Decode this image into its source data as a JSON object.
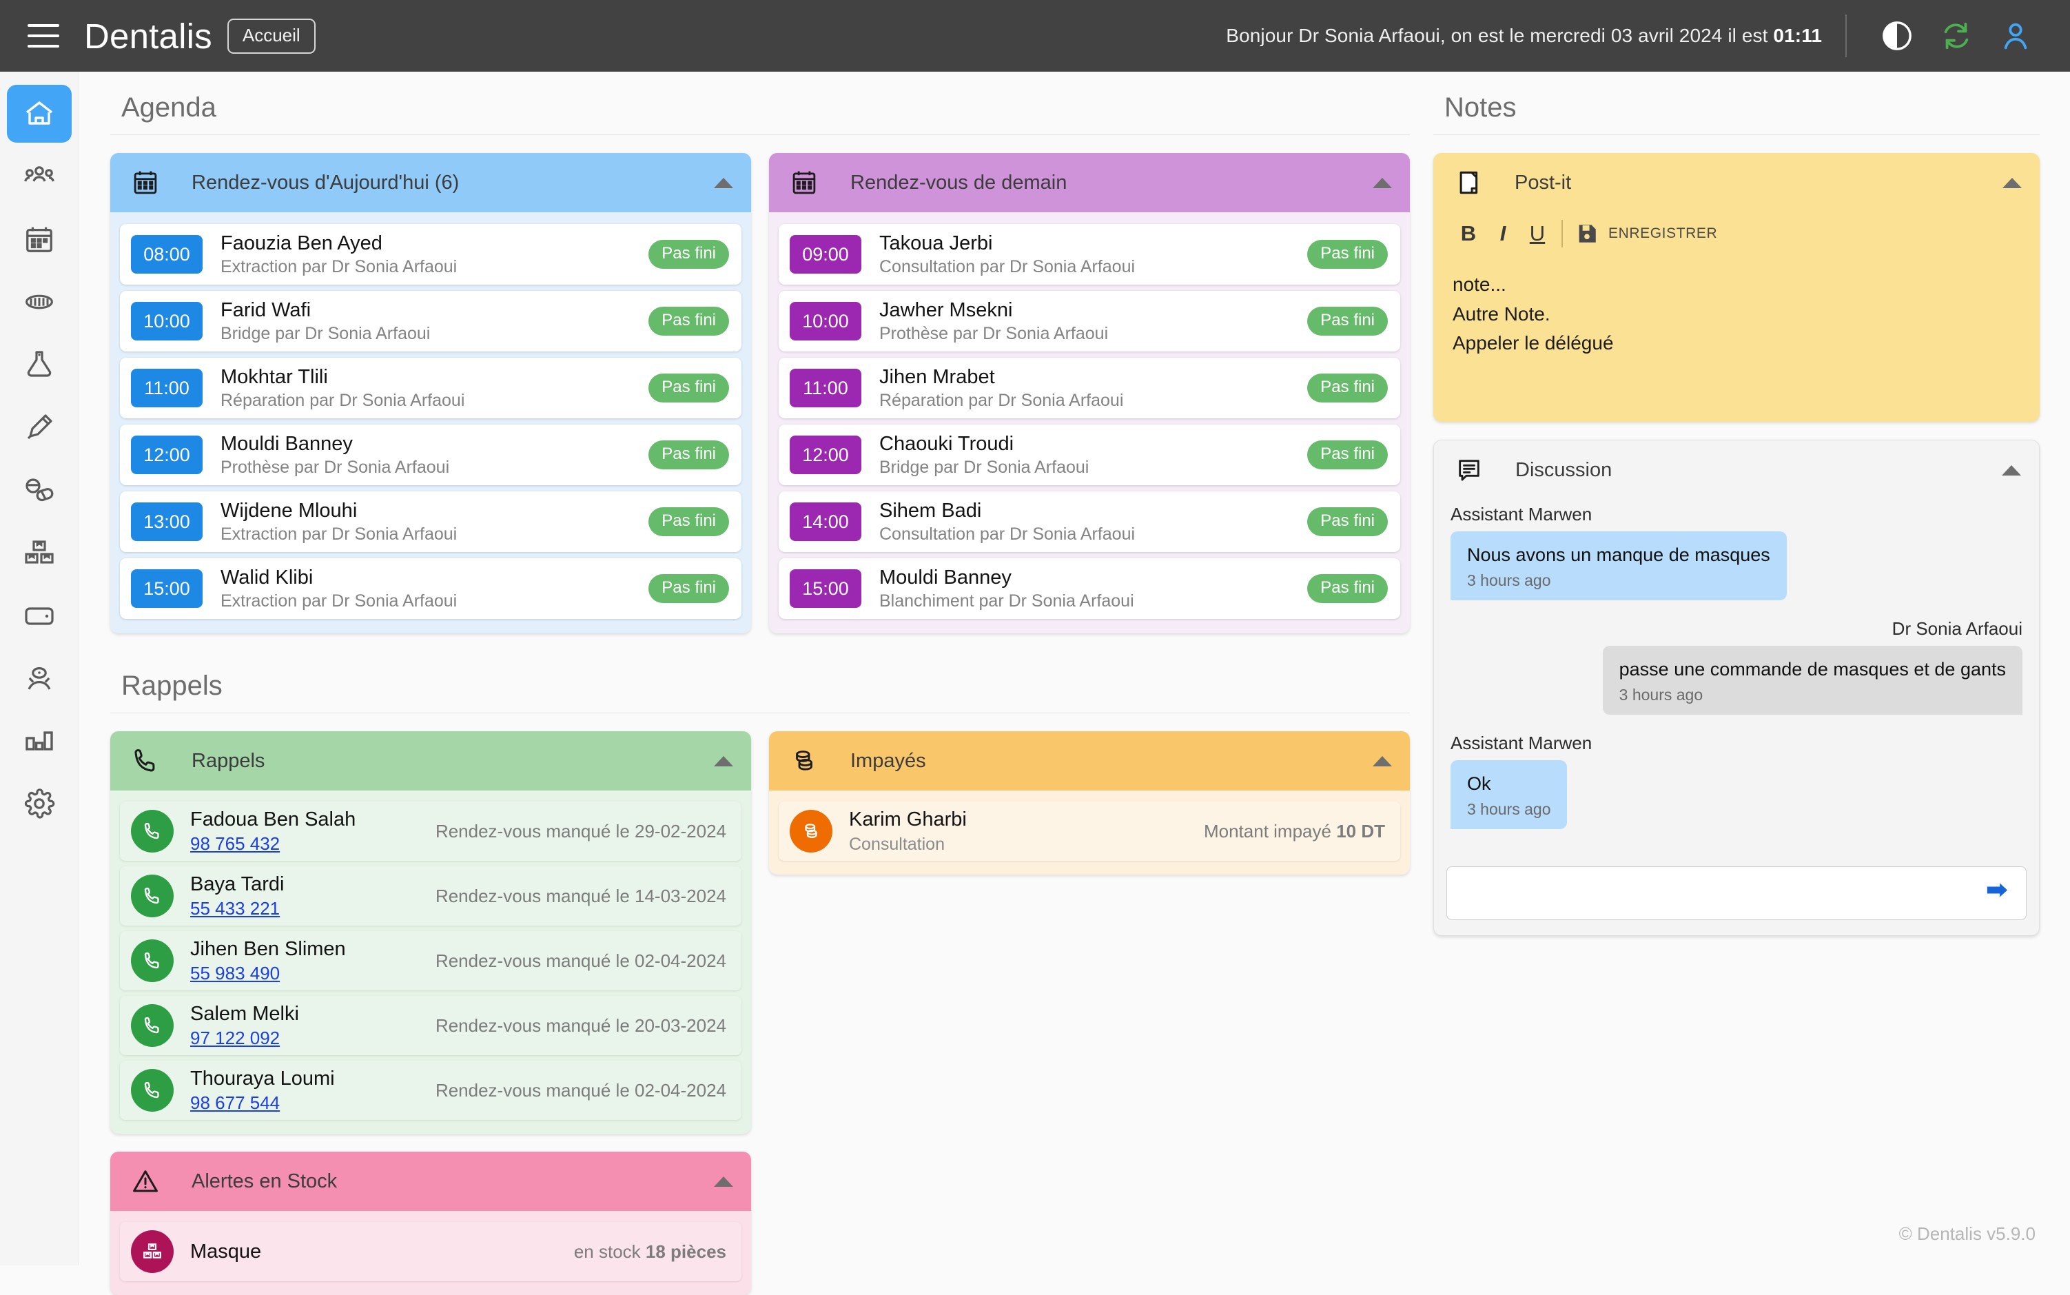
{
  "topbar": {
    "menu_icon": "hamburger-icon",
    "brand": "Dentalis",
    "home_badge": "Accueil",
    "greeting_prefix": "Bonjour Dr Sonia Arfaoui, on est le mercredi 03 avril 2024 il est ",
    "greeting_time": "01:11",
    "icons": [
      "contrast-toggle-icon",
      "refresh-icon",
      "user-account-icon"
    ]
  },
  "sidebar": {
    "items": [
      {
        "name": "home",
        "label": "Accueil",
        "active": true
      },
      {
        "name": "patients",
        "label": "Patients",
        "active": false
      },
      {
        "name": "calendar",
        "label": "Agenda",
        "active": false
      },
      {
        "name": "braces",
        "label": "Orthodontie",
        "active": false
      },
      {
        "name": "lab",
        "label": "Laboratoire",
        "active": false
      },
      {
        "name": "syringe",
        "label": "Actes",
        "active": false
      },
      {
        "name": "pills",
        "label": "Ordonnances",
        "active": false
      },
      {
        "name": "stock",
        "label": "Stock",
        "active": false
      },
      {
        "name": "wallet",
        "label": "Caisse",
        "active": false
      },
      {
        "name": "doctor",
        "label": "Praticiens",
        "active": false
      },
      {
        "name": "chart",
        "label": "Statistiques",
        "active": false
      },
      {
        "name": "settings",
        "label": "Parametres",
        "active": false
      }
    ]
  },
  "agenda": {
    "title": "Agenda",
    "today": {
      "icon": "calendar-icon",
      "title": "Rendez-vous d'Aujourd'hui (6)",
      "appointments": [
        {
          "time": "08:00",
          "name": "Faouzia Ben Ayed",
          "detail": "Extraction par Dr Sonia Arfaoui",
          "status": "Pas fini"
        },
        {
          "time": "10:00",
          "name": "Farid Wafi",
          "detail": "Bridge par Dr Sonia Arfaoui",
          "status": "Pas fini"
        },
        {
          "time": "11:00",
          "name": "Mokhtar Tlili",
          "detail": "Réparation par Dr Sonia Arfaoui",
          "status": "Pas fini"
        },
        {
          "time": "12:00",
          "name": "Mouldi Banney",
          "detail": "Prothèse par Dr Sonia Arfaoui",
          "status": "Pas fini"
        },
        {
          "time": "13:00",
          "name": "Wijdene Mlouhi",
          "detail": "Extraction par Dr Sonia Arfaoui",
          "status": "Pas fini"
        },
        {
          "time": "15:00",
          "name": "Walid Klibi",
          "detail": "Extraction par Dr Sonia Arfaoui",
          "status": "Pas fini"
        }
      ]
    },
    "tomorrow": {
      "icon": "calendar-icon",
      "title": "Rendez-vous de demain",
      "appointments": [
        {
          "time": "09:00",
          "name": "Takoua Jerbi",
          "detail": "Consultation par Dr Sonia Arfaoui",
          "status": "Pas fini"
        },
        {
          "time": "10:00",
          "name": "Jawher Msekni",
          "detail": "Prothèse par Dr Sonia Arfaoui",
          "status": "Pas fini"
        },
        {
          "time": "11:00",
          "name": "Jihen Mrabet",
          "detail": "Réparation par Dr Sonia Arfaoui",
          "status": "Pas fini"
        },
        {
          "time": "12:00",
          "name": "Chaouki Troudi",
          "detail": "Bridge par Dr Sonia Arfaoui",
          "status": "Pas fini"
        },
        {
          "time": "14:00",
          "name": "Sihem Badi",
          "detail": "Consultation par Dr Sonia Arfaoui",
          "status": "Pas fini"
        },
        {
          "time": "15:00",
          "name": "Mouldi Banney",
          "detail": "Blanchiment par Dr Sonia Arfaoui",
          "status": "Pas fini"
        }
      ]
    }
  },
  "rappels": {
    "title": "Rappels",
    "panel": {
      "icon": "phone-icon",
      "title": "Rappels",
      "items": [
        {
          "name": "Fadoua Ben Salah",
          "phone": "98 765 432",
          "meta": "Rendez-vous manqué le 29-02-2024"
        },
        {
          "name": "Baya Tardi",
          "phone": "55 433 221",
          "meta": "Rendez-vous manqué le 14-03-2024"
        },
        {
          "name": "Jihen Ben Slimen",
          "phone": "55 983 490",
          "meta": "Rendez-vous manqué le 02-04-2024"
        },
        {
          "name": "Salem Melki",
          "phone": "97 122 092",
          "meta": "Rendez-vous manqué le 20-03-2024"
        },
        {
          "name": "Thouraya Loumi",
          "phone": "98 677 544",
          "meta": "Rendez-vous manqué le 02-04-2024"
        }
      ]
    },
    "impayes": {
      "icon": "coins-icon",
      "title": "Impayés",
      "items": [
        {
          "name": "Karim Gharbi",
          "sub": "Consultation",
          "meta_label": "Montant impayé ",
          "meta_value": "10 DT"
        }
      ]
    },
    "stock": {
      "icon": "warning-icon",
      "title": "Alertes en Stock",
      "items": [
        {
          "name": "Masque",
          "meta_label": "en stock ",
          "meta_value": "18 pièces"
        }
      ]
    }
  },
  "notes": {
    "title": "Notes",
    "postit": {
      "icon": "note-icon",
      "title": "Post-it",
      "bold_label": "B",
      "italic_label": "I",
      "underline_label": "U",
      "save_label": "ENREGISTRER",
      "lines": [
        "note...",
        "Autre Note.",
        "Appeler le délégué"
      ]
    },
    "discussion": {
      "icon": "chat-icon",
      "title": "Discussion",
      "messages": [
        {
          "author": "Assistant Marwen",
          "text": "Nous avons un manque de masques",
          "time": "3 hours ago",
          "side": "in"
        },
        {
          "author": "Dr Sonia Arfaoui",
          "text": "passe une commande de masques et de gants",
          "time": "3 hours ago",
          "side": "out"
        },
        {
          "author": "Assistant Marwen",
          "text": "Ok",
          "time": "3 hours ago",
          "side": "in"
        }
      ],
      "input_value": "",
      "input_placeholder": "",
      "send_icon": "send-icon"
    }
  },
  "footer": {
    "text": "© Dentalis v5.9.0"
  },
  "colors": {
    "topbar": "#424242",
    "accent_blue": "#1e88e5",
    "today_header": "#90caf9",
    "tomorrow_header": "#ce93d8",
    "tomorrow_chip": "#9c27b0",
    "green": "#66bb6a",
    "rappels_header": "#a5d6a7",
    "impayes_header": "#f9c66a",
    "impayes_circle": "#ef6c00",
    "stock_header": "#f48fb1",
    "stock_circle": "#ad1457",
    "postit": "#fbe193"
  }
}
